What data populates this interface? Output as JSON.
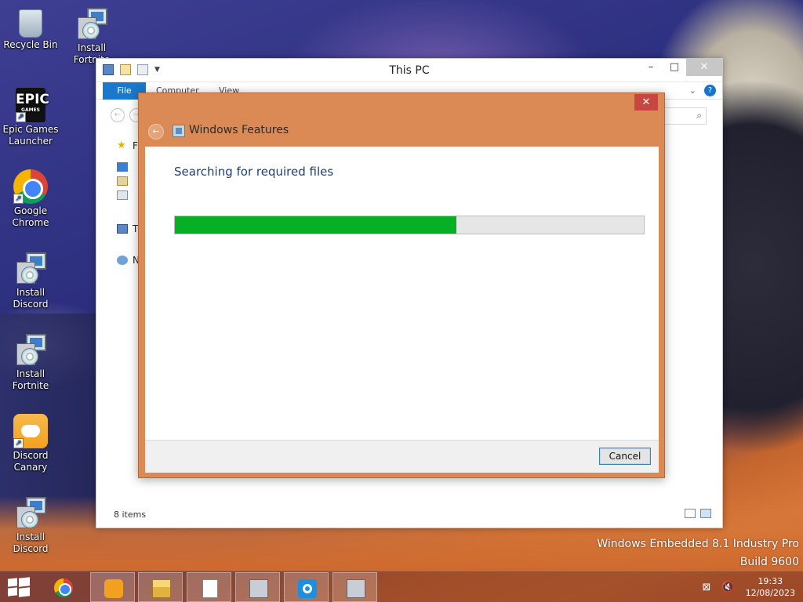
{
  "desktop": {
    "icons": [
      {
        "label": "Recycle Bin"
      },
      {
        "label": "Install Fortnite"
      },
      {
        "label": "Epic Games Launcher"
      },
      {
        "label": "Google Chrome"
      },
      {
        "label": "Install Discord"
      },
      {
        "label": "Install Fortnite"
      },
      {
        "label": "Discord Canary"
      },
      {
        "label": "Install Discord"
      }
    ],
    "epic_logo_text": "EPIC",
    "epic_logo_sub": "GAMES"
  },
  "explorer": {
    "title": "This PC",
    "tabs": {
      "file": "File",
      "computer": "Computer",
      "view": "View"
    },
    "nav_items": [
      "F",
      "T",
      "N"
    ],
    "status": "8 items"
  },
  "dialog": {
    "title": "Windows Features",
    "heading": "Searching for required files",
    "progress": 0.6,
    "cancel_label": "Cancel",
    "close_glyph": "✕"
  },
  "watermark": {
    "line1": "Windows Embedded 8.1 Industry Pro",
    "line2": "Build 9600"
  },
  "taskbar": {
    "time": "19:33",
    "date": "12/08/2023"
  },
  "colors": {
    "progress_fill": "#06b025",
    "dialog_frame": "#dc8a55",
    "file_tab": "#1979ca",
    "close_red": "#c7463f"
  }
}
